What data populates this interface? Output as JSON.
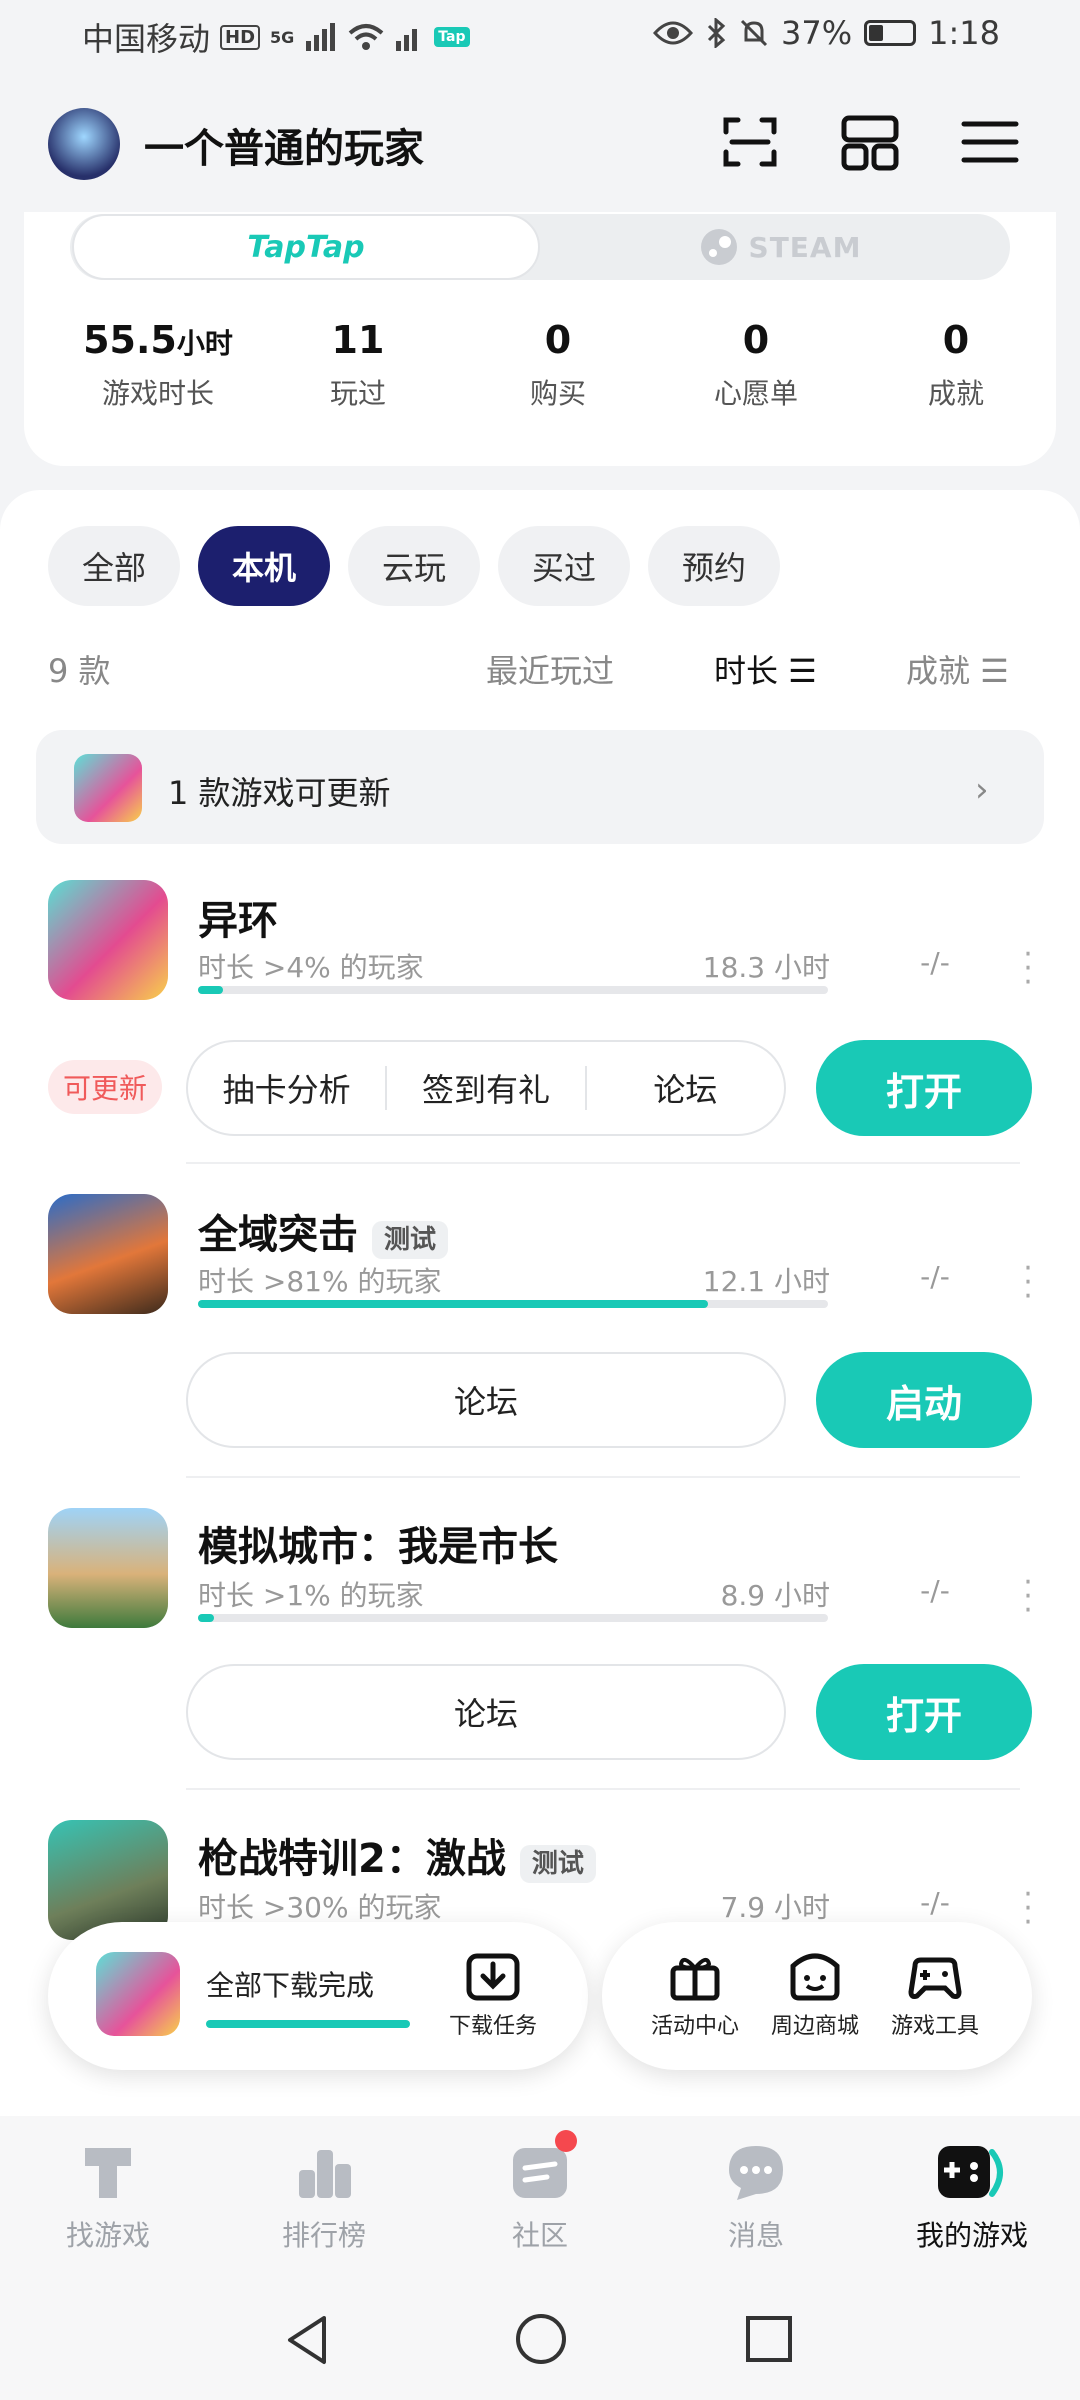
{
  "status": {
    "carrier": "中国移动",
    "hd": "HD",
    "net": "5G",
    "battery": "37%",
    "time": "1:18",
    "tap": "Tap"
  },
  "header": {
    "username": "一个普通的玩家"
  },
  "platforms": {
    "taptap": "TapTap",
    "steam": "STEAM"
  },
  "stats": [
    {
      "value": "55.5",
      "unit": "小时",
      "label": "游戏时长"
    },
    {
      "value": "11",
      "label": "玩过"
    },
    {
      "value": "0",
      "label": "购买"
    },
    {
      "value": "0",
      "label": "心愿单"
    },
    {
      "value": "0",
      "label": "成就"
    }
  ],
  "filters": [
    "全部",
    "本机",
    "云玩",
    "买过",
    "预约"
  ],
  "list": {
    "count": "9 款",
    "sort_recent": "最近玩过",
    "sort_duration": "时长 ☰",
    "sort_achievement": "成就 ☰"
  },
  "update_banner": {
    "text": "1 款游戏可更新"
  },
  "games": [
    {
      "name": "异环",
      "subtitle": "时长 >4% 的玩家",
      "hours": "18.3 小时",
      "achievement": "-/-",
      "progress": 0.04,
      "update_badge": "可更新",
      "actions": [
        "抽卡分析",
        "签到有礼",
        "论坛"
      ],
      "primary": "打开"
    },
    {
      "name": "全域突击",
      "tag": "测试",
      "subtitle": "时长 >81% 的玩家",
      "hours": "12.1 小时",
      "achievement": "-/-",
      "progress": 0.81,
      "actions": [
        "论坛"
      ],
      "primary": "启动"
    },
    {
      "name": "模拟城市：我是市长",
      "subtitle": "时长 >1% 的玩家",
      "hours": "8.9 小时",
      "achievement": "-/-",
      "progress": 0.01,
      "actions": [
        "论坛"
      ],
      "primary": "打开"
    },
    {
      "name": "枪战特训2：激战",
      "tag": "测试",
      "subtitle": "时长 >30% 的玩家",
      "hours": "7.9 小时",
      "achievement": "-/-",
      "progress": 0.3
    }
  ],
  "float": {
    "download_status": "全部下载完成",
    "download_tasks": "下载任务",
    "activity": "活动中心",
    "shop": "周边商城",
    "tools": "游戏工具"
  },
  "nav": [
    "找游戏",
    "排行榜",
    "社区",
    "消息",
    "我的游戏"
  ],
  "colors": {
    "accent": "#19c9b6",
    "active_filter": "#1c1f6e",
    "update_red": "#f05a5a"
  }
}
